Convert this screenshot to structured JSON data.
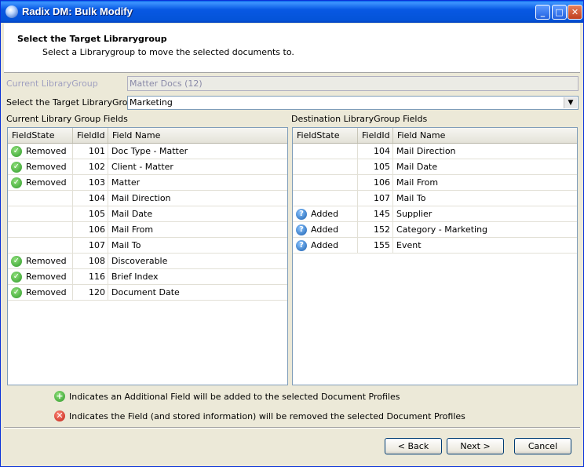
{
  "window": {
    "title": "Radix DM: Bulk Modify"
  },
  "header": {
    "title": "Select the Target Librarygroup",
    "subtitle": "Select a Librarygroup to move the selected documents to."
  },
  "current_group": {
    "label": "Current LibraryGroup",
    "value": "Matter Docs (12)"
  },
  "target_group": {
    "label": "Select the Target LibraryGroup",
    "value": "Marketing"
  },
  "left_grid": {
    "title": "Current Library Group Fields",
    "columns": [
      "FieldState",
      "FieldId",
      "Field Name"
    ],
    "rows": [
      {
        "state": "Removed",
        "icon": "check-icon",
        "id": "101",
        "name": "Doc Type - Matter"
      },
      {
        "state": "Removed",
        "icon": "check-icon",
        "id": "102",
        "name": "Client - Matter"
      },
      {
        "state": "Removed",
        "icon": "check-icon",
        "id": "103",
        "name": "Matter"
      },
      {
        "state": "",
        "icon": "",
        "id": "104",
        "name": "Mail Direction"
      },
      {
        "state": "",
        "icon": "",
        "id": "105",
        "name": "Mail Date"
      },
      {
        "state": "",
        "icon": "",
        "id": "106",
        "name": "Mail From"
      },
      {
        "state": "",
        "icon": "",
        "id": "107",
        "name": "Mail To"
      },
      {
        "state": "Removed",
        "icon": "check-icon",
        "id": "108",
        "name": "Discoverable"
      },
      {
        "state": "Removed",
        "icon": "check-icon",
        "id": "116",
        "name": "Brief Index"
      },
      {
        "state": "Removed",
        "icon": "check-icon",
        "id": "120",
        "name": "Document Date"
      }
    ]
  },
  "right_grid": {
    "title": "Destination LibraryGroup Fields",
    "columns": [
      "FieldState",
      "FieldId",
      "Field Name"
    ],
    "rows": [
      {
        "state": "",
        "icon": "",
        "id": "104",
        "name": "Mail Direction"
      },
      {
        "state": "",
        "icon": "",
        "id": "105",
        "name": "Mail Date"
      },
      {
        "state": "",
        "icon": "",
        "id": "106",
        "name": "Mail From"
      },
      {
        "state": "",
        "icon": "",
        "id": "107",
        "name": "Mail To"
      },
      {
        "state": "Added",
        "icon": "question-icon",
        "id": "145",
        "name": "Supplier"
      },
      {
        "state": "Added",
        "icon": "question-icon",
        "id": "152",
        "name": "Category - Marketing"
      },
      {
        "state": "Added",
        "icon": "question-icon",
        "id": "155",
        "name": "Event"
      }
    ]
  },
  "legend": {
    "added": "Indicates an Additional Field will be added to the selected Document Profiles",
    "removed": "Indicates the Field (and stored information) will be removed the selected Document Profiles"
  },
  "buttons": {
    "back": "< Back",
    "next": "Next >",
    "cancel": "Cancel"
  }
}
